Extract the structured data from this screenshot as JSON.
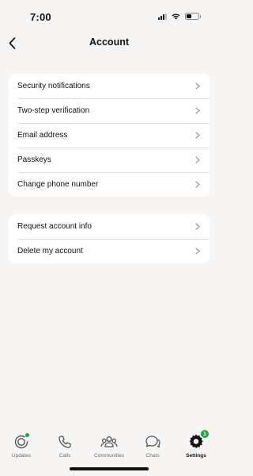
{
  "status_bar": {
    "time": "7:00"
  },
  "nav": {
    "title": "Account"
  },
  "group1": {
    "items": [
      {
        "label": "Security notifications"
      },
      {
        "label": "Two-step verification"
      },
      {
        "label": "Email address"
      },
      {
        "label": "Passkeys"
      },
      {
        "label": "Change phone number"
      }
    ]
  },
  "group2": {
    "items": [
      {
        "label": "Request account info"
      },
      {
        "label": "Delete my account"
      }
    ]
  },
  "tab_bar": {
    "tabs": [
      {
        "label": "Updates",
        "icon": "updates-icon"
      },
      {
        "label": "Calls",
        "icon": "phone-icon"
      },
      {
        "label": "Communities",
        "icon": "communities-icon"
      },
      {
        "label": "Chats",
        "icon": "chats-icon"
      },
      {
        "label": "Settings",
        "icon": "settings-icon",
        "active": true,
        "badge": "1"
      }
    ]
  },
  "colors": {
    "accent": "#25a244",
    "background": "#f6f5f3",
    "card": "#ffffff"
  }
}
